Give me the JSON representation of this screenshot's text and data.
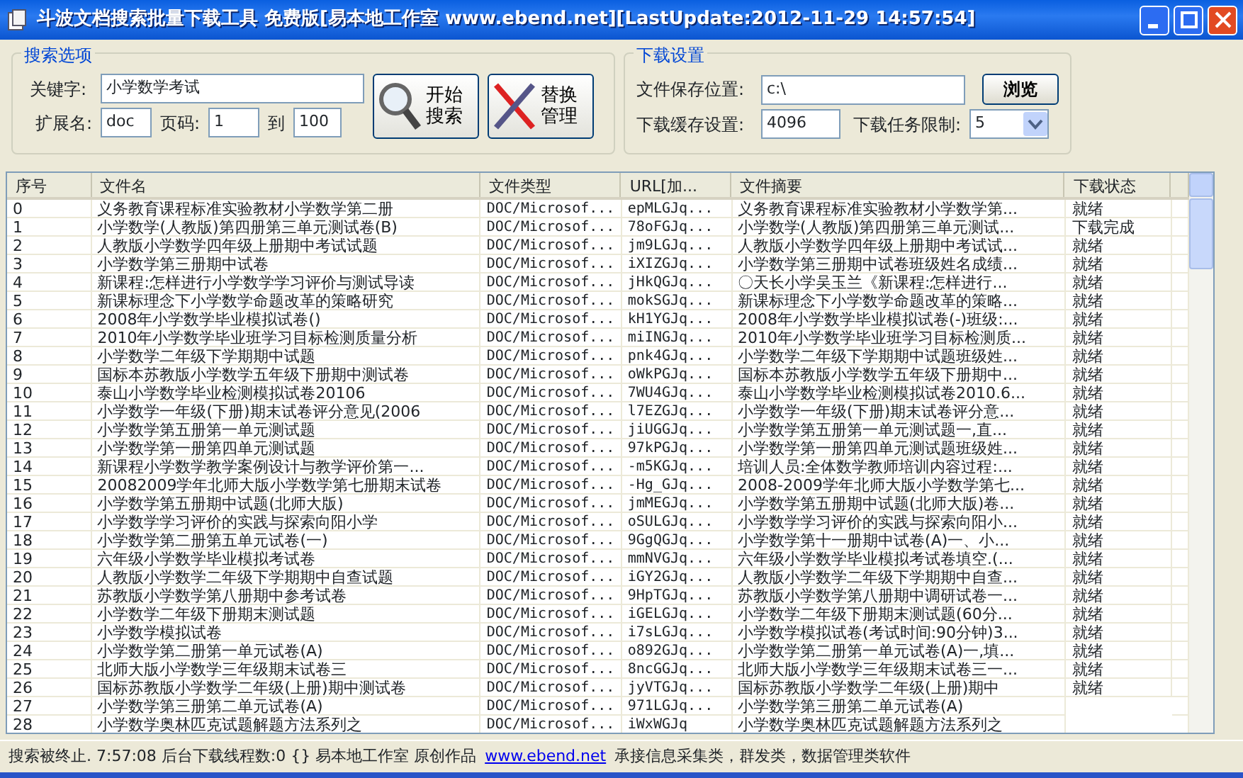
{
  "window": {
    "title": "斗波文档搜索批量下载工具 免费版[易本地工作室 www.ebend.net][LastUpdate:2012-11-29 14:57:54]"
  },
  "search_options": {
    "title": "搜索选项",
    "keyword_label": "关键字:",
    "keyword": "小学数学考试",
    "ext_label": "扩展名:",
    "ext": "doc",
    "page_label": "页码:",
    "page_from": "1",
    "to_label": "到",
    "page_to": "100",
    "start_button": "开始搜索",
    "replace_button": "替换管理"
  },
  "download_settings": {
    "title": "下载设置",
    "path_label": "文件保存位置:",
    "path": "c:\\",
    "browse_button": "浏览",
    "cache_label": "下载缓存设置:",
    "cache": "4096",
    "limit_label": "下载任务限制:",
    "limit": "5"
  },
  "table": {
    "columns": [
      "序号",
      "文件名",
      "文件类型",
      "URL[加...",
      "文件摘要",
      "下载状态"
    ],
    "rows": [
      {
        "no": "0",
        "name": "义务教育课程标准实验教材小学数学第二册",
        "type": "DOC/Microsof...",
        "url": "epMLGJq...",
        "summary": "义务教育课程标准实验教材小学数学第...",
        "status": "就绪"
      },
      {
        "no": "1",
        "name": "小学数学(人教版)第四册第三单元测试卷(B)",
        "type": "DOC/Microsof...",
        "url": "78oFGJq...",
        "summary": "小学数学(人教版)第四册第三单元测试...",
        "status": "下载完成"
      },
      {
        "no": "2",
        "name": "人教版小学数学四年级上册期中考试试题",
        "type": "DOC/Microsof...",
        "url": "jm9LGJq...",
        "summary": "人教版小学数学四年级上册期中考试试...",
        "status": "就绪"
      },
      {
        "no": "3",
        "name": "小学数学第三册期中试卷",
        "type": "DOC/Microsof...",
        "url": "iXIZGJq...",
        "summary": "小学数学第三册期中试卷班级姓名成绩...",
        "status": "就绪"
      },
      {
        "no": "4",
        "name": "新课程:怎样进行小学数学学习评价与测试导读",
        "type": "DOC/Microsof...",
        "url": "jHkQGJq...",
        "summary": "〇天长小学吴玉兰《新课程:怎样进行...",
        "status": "就绪"
      },
      {
        "no": "5",
        "name": "新课标理念下小学数学命题改革的策略研究",
        "type": "DOC/Microsof...",
        "url": "mokSGJq...",
        "summary": "新课标理念下小学数学命题改革的策略...",
        "status": "就绪"
      },
      {
        "no": "6",
        "name": "2008年小学数学毕业模拟试卷()",
        "type": "DOC/Microsof...",
        "url": "kH1YGJq...",
        "summary": "2008年小学数学毕业模拟试卷(-)班级:...",
        "status": "就绪"
      },
      {
        "no": "7",
        "name": "2010年小学数学毕业班学习目标检测质量分析",
        "type": "DOC/Microsof...",
        "url": "miINGJq...",
        "summary": "2010年小学数学毕业班学习目标检测质...",
        "status": "就绪"
      },
      {
        "no": "8",
        "name": "小学数学二年级下学期期中试题",
        "type": "DOC/Microsof...",
        "url": "pnk4GJq...",
        "summary": "小学数学二年级下学期期中试题班级姓...",
        "status": "就绪"
      },
      {
        "no": "9",
        "name": "国标本苏教版小学数学五年级下册期中测试卷",
        "type": "DOC/Microsof...",
        "url": "oWkPGJq...",
        "summary": "国标本苏教版小学数学五年级下册期中...",
        "status": "就绪"
      },
      {
        "no": "10",
        "name": "泰山小学数学毕业检测模拟试卷20106",
        "type": "DOC/Microsof...",
        "url": "7WU4GJq...",
        "summary": "泰山小学数学毕业检测模拟试卷2010.6...",
        "status": "就绪"
      },
      {
        "no": "11",
        "name": "小学数学一年级(下册)期末试卷评分意见(2006",
        "type": "DOC/Microsof...",
        "url": "l7EZGJq...",
        "summary": "小学数学一年级(下册)期末试卷评分意...",
        "status": "就绪"
      },
      {
        "no": "12",
        "name": "小学数学第五册第一单元测试题",
        "type": "DOC/Microsof...",
        "url": "jiUGGJq...",
        "summary": "小学数学第五册第一单元测试题一,直...",
        "status": "就绪"
      },
      {
        "no": "13",
        "name": "小学数学第一册第四单元测试题",
        "type": "DOC/Microsof...",
        "url": "97kPGJq...",
        "summary": "小学数学第一册第四单元测试题班级姓...",
        "status": "就绪"
      },
      {
        "no": "14",
        "name": "新课程小学数学教学案例设计与教学评价第一...",
        "type": "DOC/Microsof...",
        "url": "-m5KGJq...",
        "summary": "培训人员:全体数学教师培训内容过程:...",
        "status": "就绪"
      },
      {
        "no": "15",
        "name": "20082009学年北师大版小学数学第七册期末试卷",
        "type": "DOC/Microsof...",
        "url": "-Hg_GJq...",
        "summary": "2008-2009学年北师大版小学数学第七...",
        "status": "就绪"
      },
      {
        "no": "16",
        "name": "小学数学第五册期中试题(北师大版)",
        "type": "DOC/Microsof...",
        "url": "jmMEGJq...",
        "summary": "小学数学第五册期中试题(北师大版)卷...",
        "status": "就绪"
      },
      {
        "no": "17",
        "name": "小学数学学习评价的实践与探索向阳小学",
        "type": "DOC/Microsof...",
        "url": "oSULGJq...",
        "summary": "小学数学学习评价的实践与探索向阳小...",
        "status": "就绪"
      },
      {
        "no": "18",
        "name": "小学数学第二册第五单元试卷(一)",
        "type": "DOC/Microsof...",
        "url": "9GgQGJq...",
        "summary": "小学数学第十一册期中试卷(A)一、小...",
        "status": "就绪"
      },
      {
        "no": "19",
        "name": "六年级小学数学毕业模拟考试卷",
        "type": "DOC/Microsof...",
        "url": "mmNVGJq...",
        "summary": "六年级小学数学毕业模拟考试卷填空.(...",
        "status": "就绪"
      },
      {
        "no": "20",
        "name": "人教版小学数学二年级下学期期中自查试题",
        "type": "DOC/Microsof...",
        "url": "iGY2GJq...",
        "summary": "人教版小学数学二年级下学期期中自查...",
        "status": "就绪"
      },
      {
        "no": "21",
        "name": "苏教版小学数学第八册期中参考试卷",
        "type": "DOC/Microsof...",
        "url": "9HpTGJq...",
        "summary": "苏教版小学数学第八册期中调研试卷一...",
        "status": "就绪"
      },
      {
        "no": "22",
        "name": "小学数学二年级下册期末测试题",
        "type": "DOC/Microsof...",
        "url": "iGELGJq...",
        "summary": "小学数学二年级下册期末测试题(60分...",
        "status": "就绪"
      },
      {
        "no": "23",
        "name": "小学数学模拟试卷",
        "type": "DOC/Microsof...",
        "url": "i7sLGJq...",
        "summary": "小学数学模拟试卷(考试时间:90分钟)3...",
        "status": "就绪"
      },
      {
        "no": "24",
        "name": "小学数学第二册第一单元试卷(A)",
        "type": "DOC/Microsof...",
        "url": "o892GJq...",
        "summary": "小学数学第二册第一单元试卷(A)一,填...",
        "status": "就绪"
      },
      {
        "no": "25",
        "name": "北师大版小学数学三年级期末试卷三",
        "type": "DOC/Microsof...",
        "url": "8ncGGJq...",
        "summary": "北师大版小学数学三年级期末试卷三一...",
        "status": "就绪"
      },
      {
        "no": "26",
        "name": "国标苏教版小学数学二年级(上册)期中测试卷",
        "type": "DOC/Microsof...",
        "url": "jyVTGJq...",
        "summary": "国标苏教版小学数学二年级(上册)期中",
        "status": "就绪"
      },
      {
        "no": "27",
        "name": "小学数学第三册第二单元试卷(A)",
        "type": "DOC/Microsof...",
        "url": "971LGJq...",
        "summary": "小学数学第三册第二单元试卷(A)"
      },
      {
        "no": "28",
        "name": "小学数学奥林匹克试题解题方法系列之",
        "type": "DOC/Microsof...",
        "url": "iWxWGJq",
        "summary": "小学数学奥林匹克试题解题方法系列之"
      }
    ]
  },
  "status_bar": {
    "message": "搜索被终止. 7:57:08 后台下载线程数:0 {} 易本地工作室 原创作品",
    "link": "www.ebend.net",
    "tagline": "承接信息采集类，群发类，数据管理类软件"
  }
}
